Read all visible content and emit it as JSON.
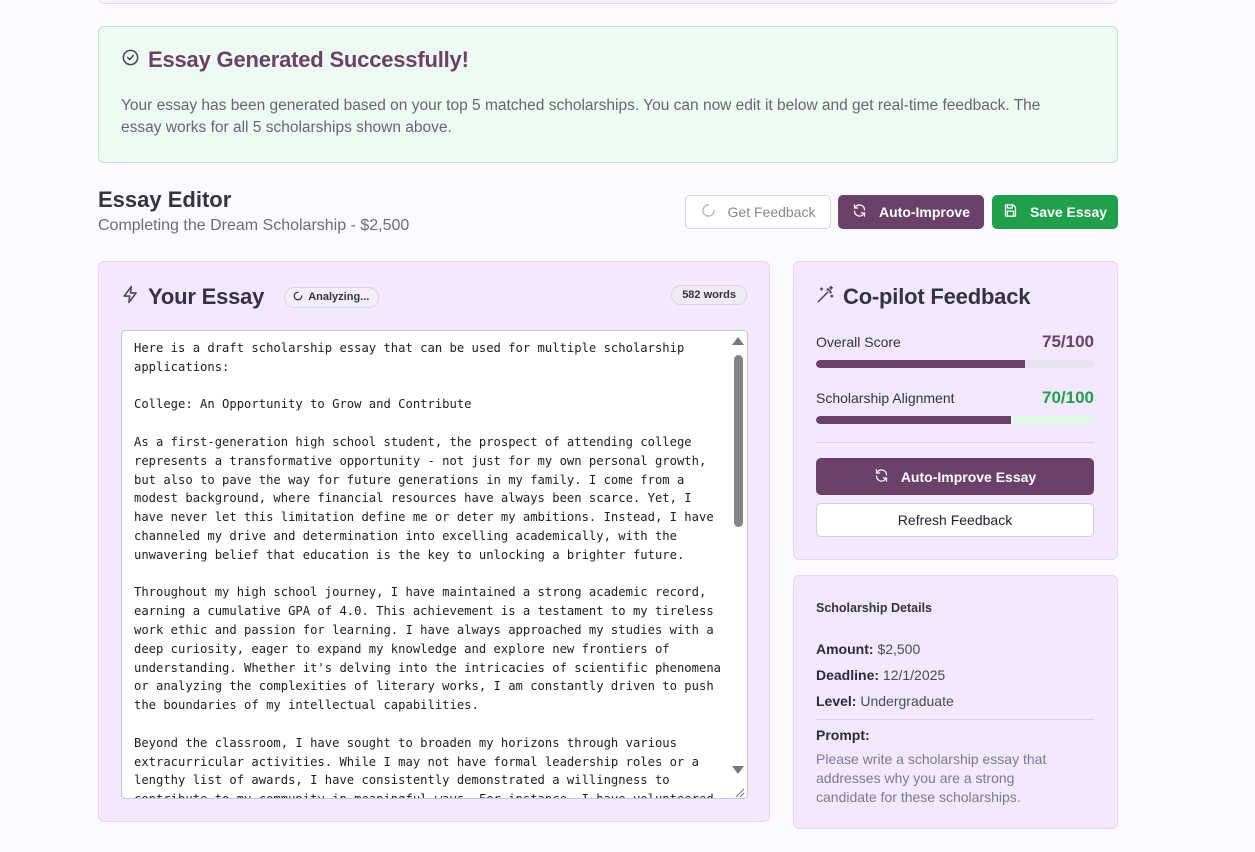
{
  "banner": {
    "title": "Essay Generated Successfully!",
    "text": "Your essay has been generated based on your top 5 matched scholarships. You can now edit it below and get real-time feedback. The essay works for all 5 scholarships shown above."
  },
  "editor": {
    "title": "Essay Editor",
    "subtitle": "Completing the Dream Scholarship - $2,500",
    "get_feedback_label": "Get Feedback",
    "auto_improve_label": "Auto-Improve",
    "save_label": "Save Essay"
  },
  "essay": {
    "title": "Your Essay",
    "status": "Analyzing...",
    "word_count": "582 words",
    "text": "Here is a draft scholarship essay that can be used for multiple scholarship applications:\n\nCollege: An Opportunity to Grow and Contribute\n\nAs a first-generation high school student, the prospect of attending college represents a transformative opportunity - not just for my own personal growth, but also to pave the way for future generations in my family. I come from a modest background, where financial resources have always been scarce. Yet, I have never let this limitation define me or deter my ambitions. Instead, I have channeled my drive and determination into excelling academically, with the unwavering belief that education is the key to unlocking a brighter future.\n\nThroughout my high school journey, I have maintained a strong academic record, earning a cumulative GPA of 4.0. This achievement is a testament to my tireless work ethic and passion for learning. I have always approached my studies with a deep curiosity, eager to expand my knowledge and explore new frontiers of understanding. Whether it's delving into the intricacies of scientific phenomena or analyzing the complexities of literary works, I am constantly driven to push the boundaries of my intellectual capabilities.\n\nBeyond the classroom, I have sought to broaden my horizons through various extracurricular activities. While I may not have formal leadership roles or a lengthy list of awards, I have consistently demonstrated a willingness to contribute to my community in meaningful ways. For instance, I have volunteered"
  },
  "copilot": {
    "title": "Co-pilot Feedback",
    "overall_label": "Overall Score",
    "overall_value": "75/100",
    "overall_score": 75,
    "alignment_label": "Scholarship Alignment",
    "alignment_value": "70/100",
    "alignment_score": 70,
    "auto_improve_label": "Auto-Improve Essay",
    "refresh_label": "Refresh Feedback"
  },
  "details": {
    "title": "Scholarship Details",
    "amount_label": "Amount:",
    "amount_value": "$2,500",
    "deadline_label": "Deadline:",
    "deadline_value": "12/1/2025",
    "level_label": "Level:",
    "level_value": "Undergraduate",
    "prompt_label": "Prompt:",
    "prompt_text": "Please write a scholarship essay that addresses why you are a strong candidate for these scholarships."
  },
  "colors": {
    "brand_purple": "#6b4069",
    "success_green": "#1fa04a",
    "overall_bar_track": "#e9e2ee",
    "alignment_bar_fill": "#6b4069",
    "alignment_bar_track": "#dff8e7"
  }
}
